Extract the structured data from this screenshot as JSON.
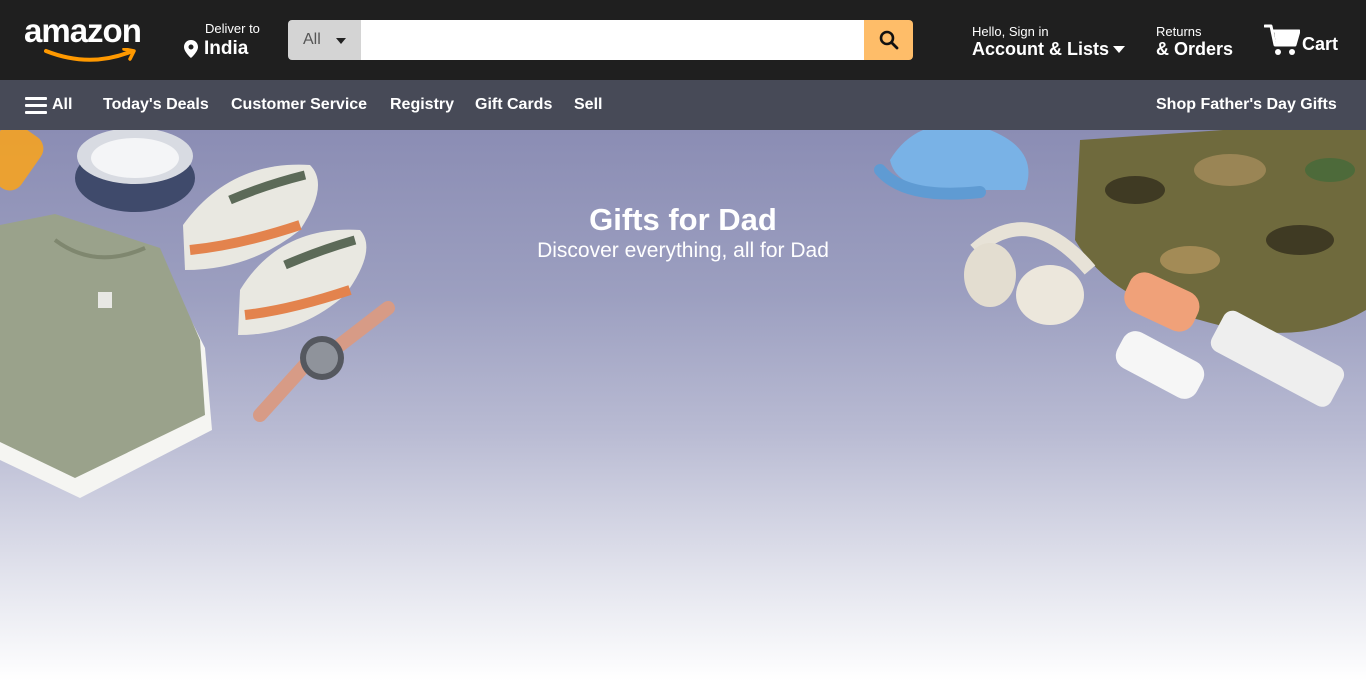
{
  "header": {
    "logo_text": "amazon",
    "deliver_label": "Deliver to",
    "deliver_location": "India",
    "search": {
      "category": "All",
      "placeholder": "",
      "value": ""
    },
    "account_greeting": "Hello, Sign in",
    "account_label": "Account & Lists",
    "returns_label": "Returns",
    "orders_label": "& Orders",
    "cart_label": "Cart"
  },
  "subnav": {
    "menu_label": "All",
    "items": [
      "Today's Deals",
      "Customer Service",
      "Registry",
      "Gift Cards",
      "Sell"
    ],
    "promo": "Shop Father's Day Gifts"
  },
  "hero": {
    "title": "Gifts for Dad",
    "subtitle": "Discover everything, all for Dad"
  },
  "colors": {
    "header_bg": "#1f1f1f",
    "subnav_bg": "#474a57",
    "search_button": "#febd69",
    "logo_smile": "#ff9900"
  },
  "icons": {
    "location": "pin-icon",
    "search": "search-icon",
    "cart": "cart-icon",
    "menu": "hamburger-icon"
  }
}
